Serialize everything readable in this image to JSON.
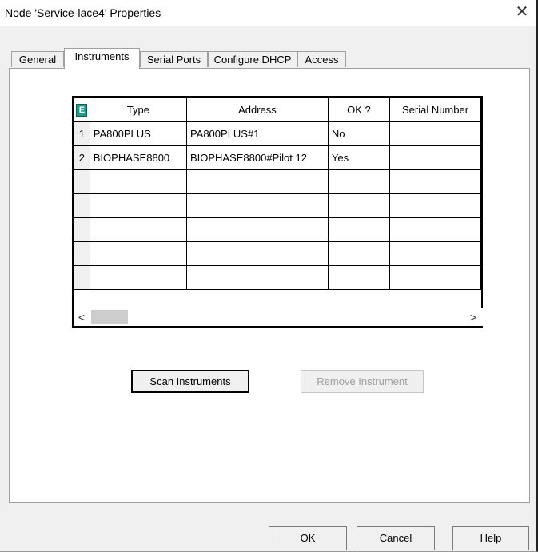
{
  "window": {
    "title": "Node 'Service-lace4' Properties",
    "close_glyph": "✕"
  },
  "tabs": [
    {
      "label": "General"
    },
    {
      "label": "Instruments"
    },
    {
      "label": "Serial Ports"
    },
    {
      "label": "Configure DHCP"
    },
    {
      "label": "Access"
    }
  ],
  "active_tab": "Instruments",
  "grid": {
    "corner_label": "E",
    "columns": [
      "Type",
      "Address",
      "OK ?",
      "Serial Number"
    ],
    "rows": [
      {
        "num": "1",
        "type": "PA800PLUS",
        "address": "PA800PLUS#1",
        "ok": "No",
        "serial": ""
      },
      {
        "num": "2",
        "type": "BIOPHASE8800",
        "address": "BIOPHASE8800#Pilot 12",
        "ok": "Yes",
        "serial": ""
      }
    ],
    "empty_row_count": 5,
    "scroll_left": "<",
    "scroll_right": ">"
  },
  "buttons": {
    "scan": "Scan Instruments",
    "remove": "Remove Instrument",
    "ok": "OK",
    "cancel": "Cancel",
    "help": "Help"
  }
}
